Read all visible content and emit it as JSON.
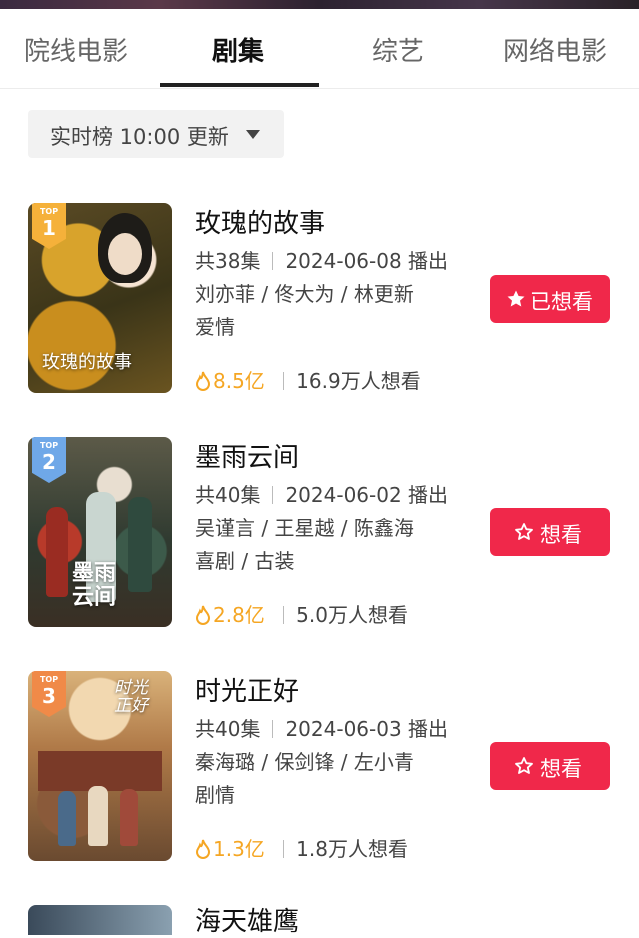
{
  "tabs": [
    {
      "label": "院线电影",
      "active": false
    },
    {
      "label": "剧集",
      "active": true
    },
    {
      "label": "综艺",
      "active": false
    },
    {
      "label": "网络电影",
      "active": false
    }
  ],
  "filter": {
    "label": "实时榜 10:00 更新"
  },
  "items": [
    {
      "rank": "1",
      "rank_tag": "TOP",
      "title": "玫瑰的故事",
      "episodes": "共38集",
      "date": "2024-06-08 播出",
      "cast": "刘亦菲 / 佟大为 / 林更新",
      "genre": "爱情",
      "heat": "8.5亿",
      "want_count": "16.9万人想看",
      "button": "已想看",
      "wanted": true,
      "poster_text": "玫瑰的故事",
      "badge_color": "#f5b13a"
    },
    {
      "rank": "2",
      "rank_tag": "TOP",
      "title": "墨雨云间",
      "episodes": "共40集",
      "date": "2024-06-02 播出",
      "cast": "吴谨言 / 王星越 / 陈鑫海",
      "genre": "喜剧 / 古装",
      "heat": "2.8亿",
      "want_count": "5.0万人想看",
      "button": "想看",
      "wanted": false,
      "poster_text": "墨雨云间",
      "badge_color": "#6fa8e8"
    },
    {
      "rank": "3",
      "rank_tag": "TOP",
      "title": "时光正好",
      "episodes": "共40集",
      "date": "2024-06-03 播出",
      "cast": "秦海璐 / 保剑锋 / 左小青",
      "genre": "剧情",
      "heat": "1.3亿",
      "want_count": "1.8万人想看",
      "button": "想看",
      "wanted": false,
      "poster_text": "时光正好",
      "badge_color": "#f08a48"
    }
  ],
  "next_item": {
    "title": "海天雄鹰"
  },
  "colors": {
    "accent": "#f0284a",
    "heat": "#f5a623"
  }
}
